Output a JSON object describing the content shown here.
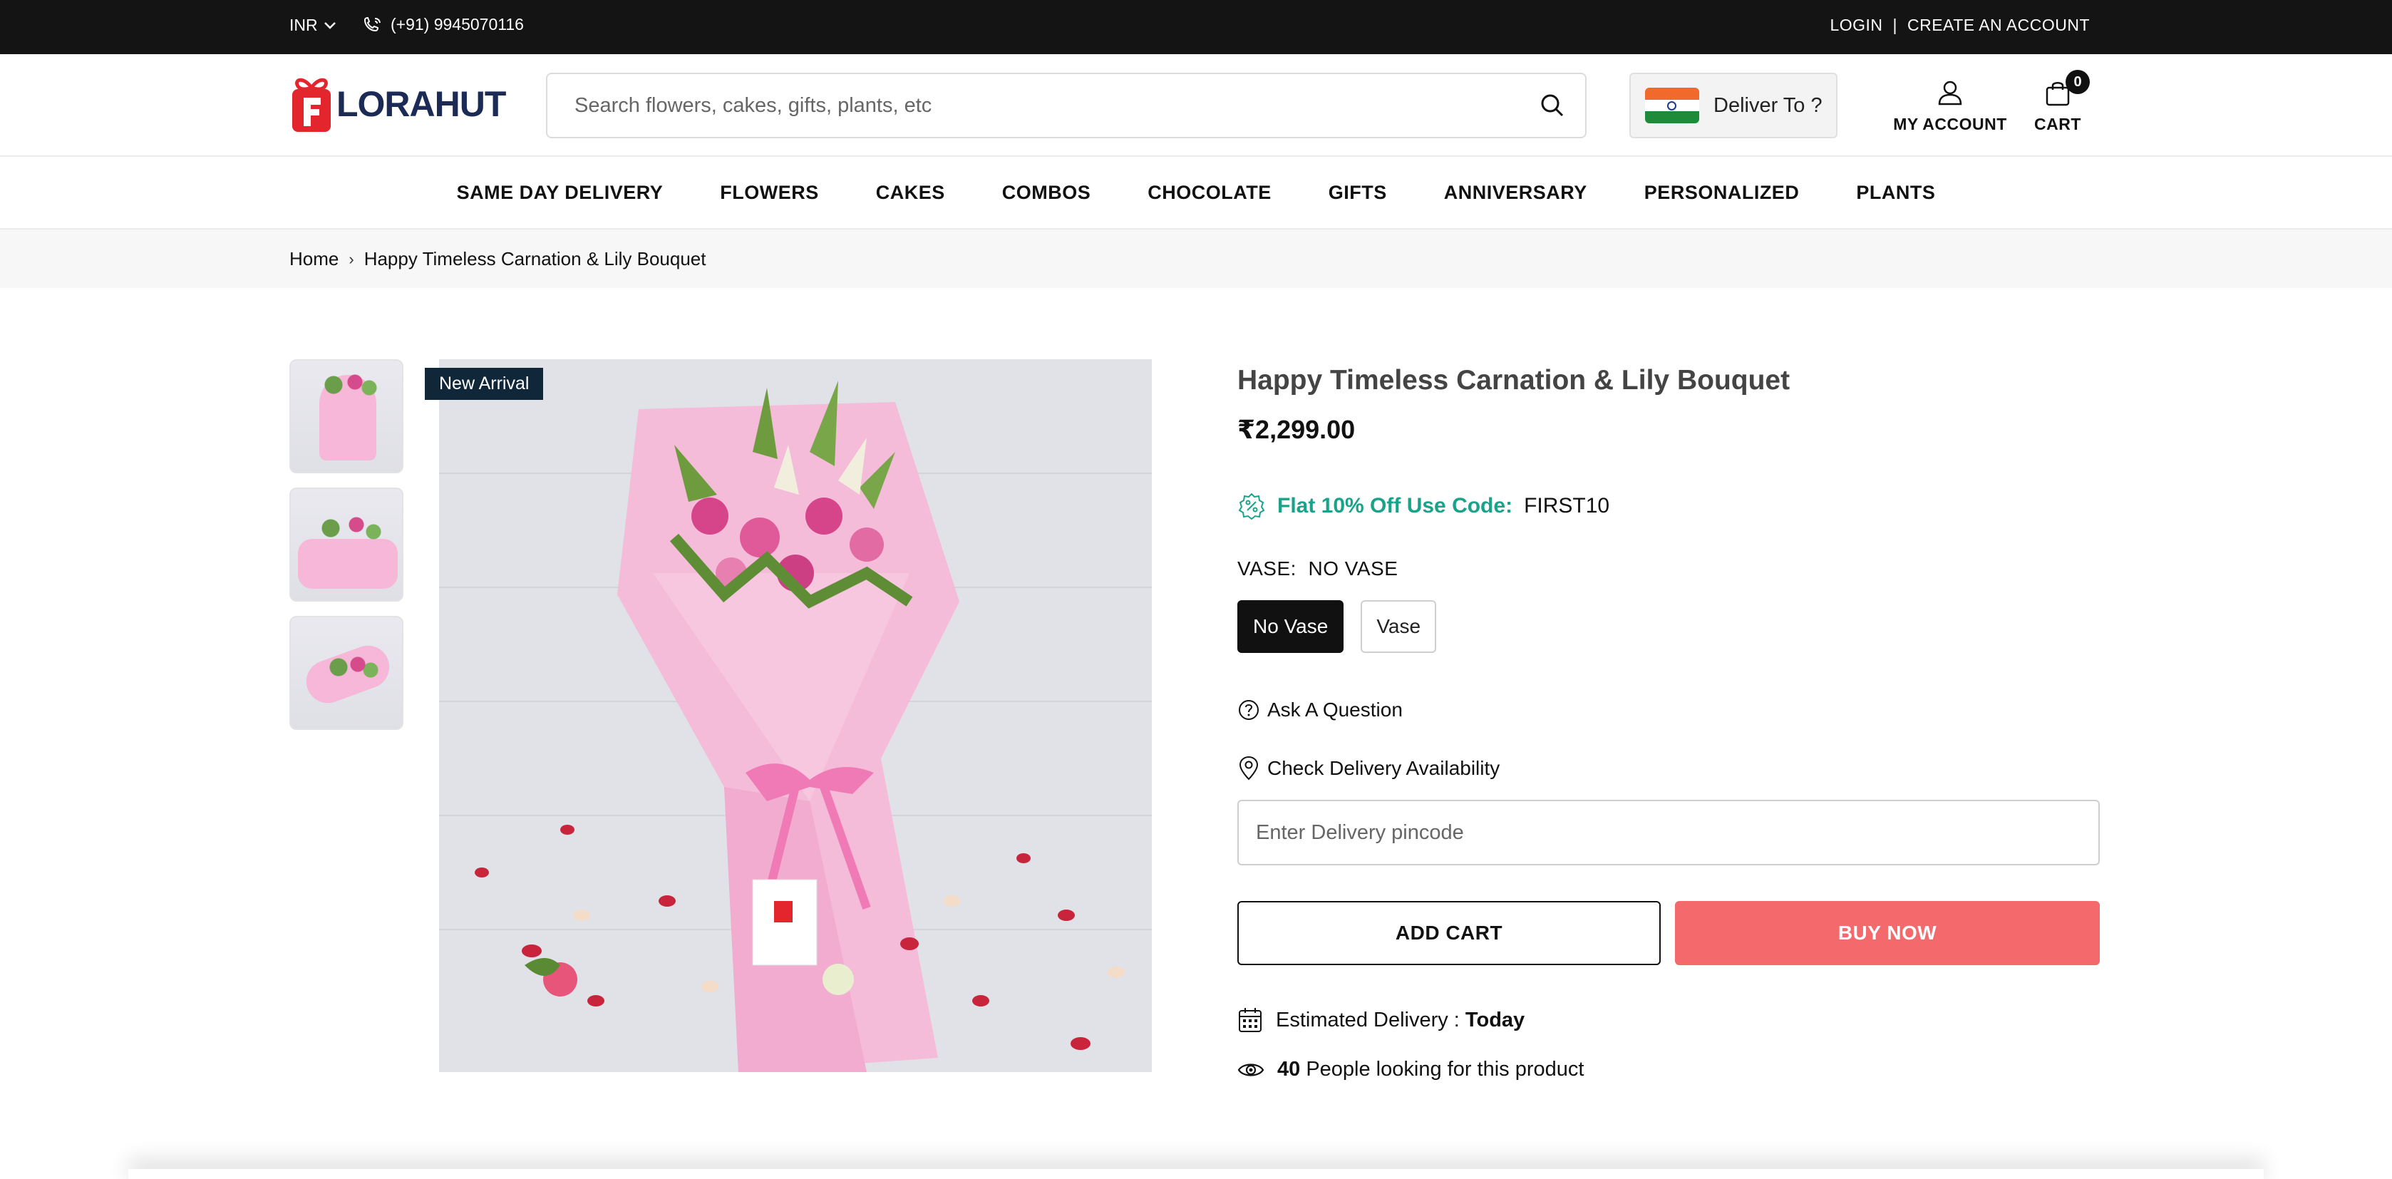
{
  "topbar": {
    "currency": "INR",
    "phone": "(+91) 9945070116",
    "login": "LOGIN",
    "separator": "|",
    "create_account": "CREATE AN ACCOUNT"
  },
  "header": {
    "logo_text": "LORAHUT",
    "search_placeholder": "Search flowers, cakes, gifts, plants, etc",
    "deliver_label": "Deliver To ?",
    "account_label": "MY ACCOUNT",
    "cart_label": "CART",
    "cart_count": "0"
  },
  "nav": {
    "items": [
      "SAME DAY DELIVERY",
      "FLOWERS",
      "CAKES",
      "COMBOS",
      "CHOCOLATE",
      "GIFTS",
      "ANNIVERSARY",
      "PERSONALIZED",
      "PLANTS"
    ]
  },
  "breadcrumb": {
    "home": "Home",
    "sep": "›",
    "current": "Happy Timeless Carnation & Lily Bouquet"
  },
  "gallery": {
    "badge": "New Arrival"
  },
  "product": {
    "title": "Happy Timeless Carnation & Lily Bouquet",
    "price": "₹2,299.00",
    "offer_text": "Flat 10% Off Use Code:",
    "offer_code": "FIRST10",
    "vase_label": "VASE:",
    "vase_selected": "NO VASE",
    "vase_options": [
      "No Vase",
      "Vase"
    ],
    "ask_question": "Ask A Question",
    "check_delivery": "Check Delivery Availability",
    "pincode_placeholder": "Enter Delivery pincode",
    "add_cart": "ADD CART",
    "buy_now": "BUY NOW",
    "estimated_label": "Estimated Delivery :",
    "estimated_value": "Today",
    "looking_count": "40",
    "looking_text": "People looking for this product"
  },
  "colors": {
    "topbar_bg": "#141414",
    "brand_red": "#e3262d",
    "brand_navy": "#1c2b55",
    "offer_green": "#19a38a",
    "buy_now_bg": "#f46a6c",
    "badge_bg": "#10273a"
  }
}
